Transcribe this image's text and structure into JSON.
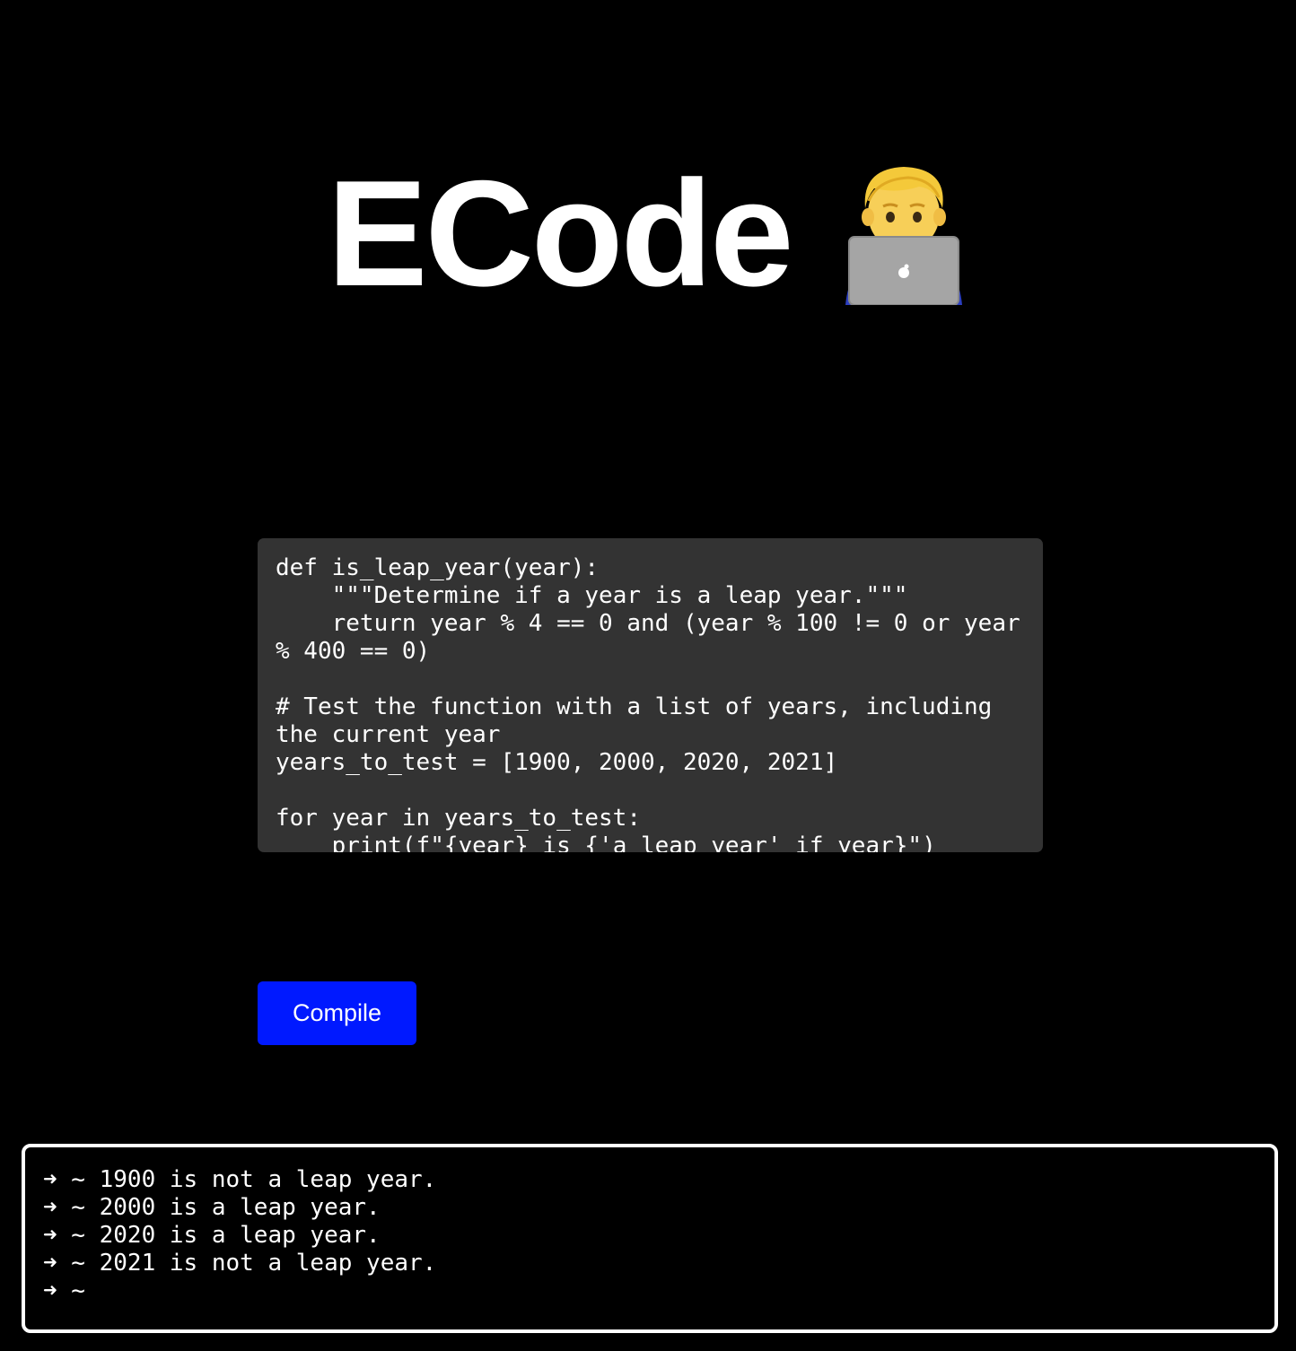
{
  "header": {
    "title": "ECode",
    "icon": "technologist-laptop-icon"
  },
  "editor": {
    "code": "def is_leap_year(year):\n    \"\"\"Determine if a year is a leap year.\"\"\"\n    return year % 4 == 0 and (year % 100 != 0 or year % 400 == 0)\n\n# Test the function with a list of years, including the current year\nyears_to_test = [1900, 2000, 2020, 2021]\n\nfor year in years_to_test:\n    print(f\"{year} is {'a leap year' if year}\")"
  },
  "toolbar": {
    "compile_label": "Compile"
  },
  "terminal": {
    "prompt": "➜ ~",
    "lines": [
      "1900 is not a leap year.",
      "2000 is a leap year.",
      "2020 is a leap year.",
      "2021 is not a leap year.",
      ""
    ]
  },
  "colors": {
    "background": "#000000",
    "editor_bg": "#333333",
    "button_bg": "#0019ff",
    "text": "#ffffff",
    "terminal_border": "#ffffff"
  }
}
